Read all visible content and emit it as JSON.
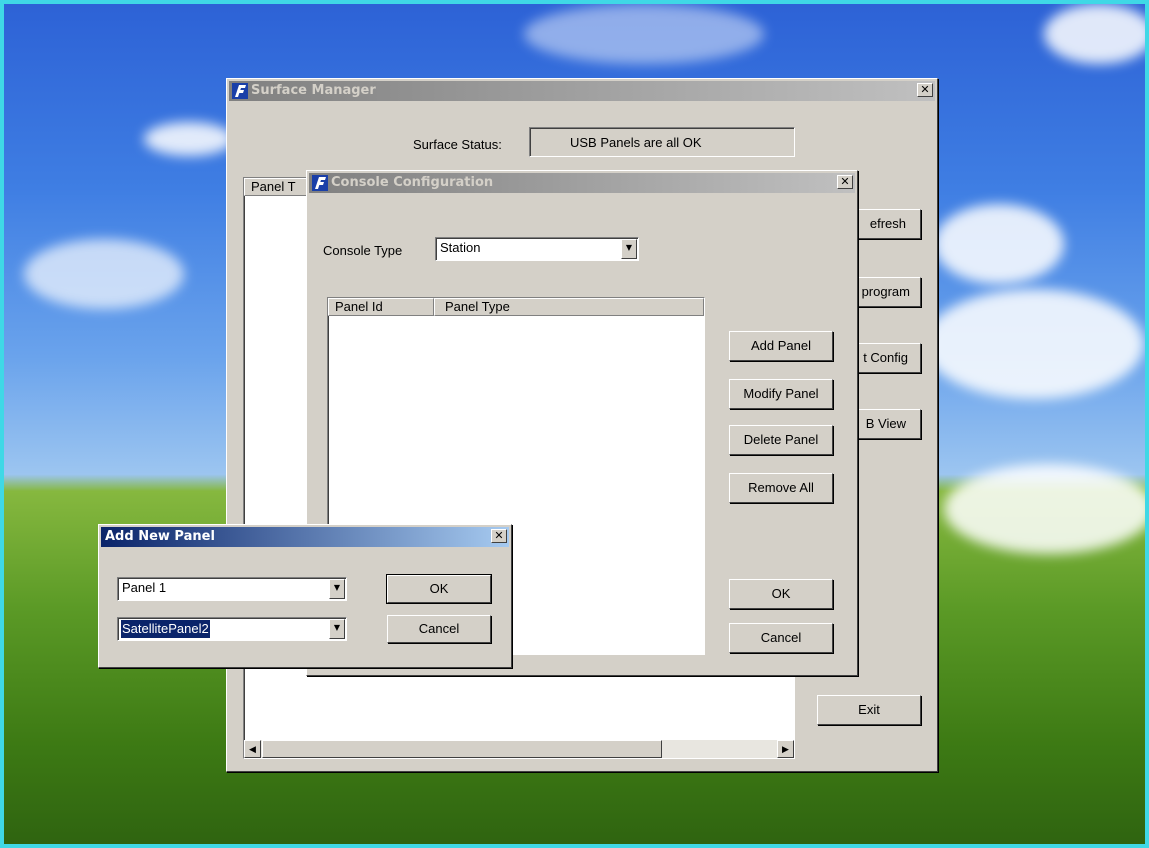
{
  "surface_manager": {
    "title": "Surface Manager",
    "status_label": "Surface Status:",
    "status_value": "USB Panels are all OK",
    "list_header_partial": "Panel T",
    "buttons": {
      "refresh": "efresh",
      "reprogram": "program",
      "config": "t Config",
      "usb_view": "B View",
      "exit": "Exit"
    }
  },
  "console_configuration": {
    "title": "Console Configuration",
    "console_type_label": "Console Type",
    "console_type_value": "Station",
    "columns": [
      "Panel Id",
      "Panel Type"
    ],
    "buttons": {
      "add_panel": "Add Panel",
      "modify_panel": "Modify Panel",
      "delete_panel": "Delete Panel",
      "remove_all": "Remove All",
      "ok": "OK",
      "cancel": "Cancel"
    }
  },
  "add_new_panel": {
    "title": "Add New Panel",
    "panel_id_value": "Panel 1",
    "panel_type_value": "SatellitePanel2",
    "buttons": {
      "ok": "OK",
      "cancel": "Cancel"
    }
  },
  "colors": {
    "desktop_border": "#3fd8e6",
    "window_face": "#d4d0c8",
    "active_title": "#0a246a",
    "inactive_title": "#808080"
  }
}
